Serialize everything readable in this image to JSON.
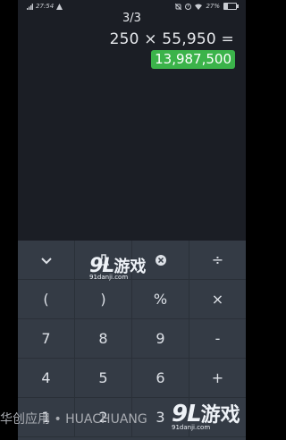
{
  "status_bar": {
    "left_icons": [
      "signal-icon",
      "signal-icon",
      "alert-icon"
    ],
    "time": "27:54",
    "right_icons": [
      "mute-icon",
      "alarm-icon",
      "wifi-icon"
    ],
    "battery_percent": "27%",
    "battery_level": 0.27
  },
  "display": {
    "history_counter": "3/3",
    "expression": "250 × 55,950 =",
    "result": "13,987,500",
    "result_color": "#3bb34a",
    "background": "#1b1e25"
  },
  "keypad": {
    "background": "#343b45",
    "row0": {
      "collapse_icon": "chevron-down-icon",
      "flask_icon": "flask-icon",
      "backspace_icon": "backspace-icon",
      "divide": "÷"
    },
    "row1": {
      "open_paren": "(",
      "close_paren": ")",
      "percent": "%",
      "multiply": "×"
    },
    "row2": {
      "seven": "7",
      "eight": "8",
      "nine": "9",
      "minus": "-"
    },
    "row3": {
      "four": "4",
      "five": "5",
      "six": "6",
      "plus": "+"
    },
    "row4": {
      "one": "1",
      "two": "2",
      "three": "3"
    }
  },
  "watermarks": {
    "center_logo": "9L",
    "center_text": "游戏",
    "center_url": "91danji.com",
    "bottom_logo": "9L",
    "bottom_text": "游戏",
    "bottom_url": "91danji.com",
    "footer": "华创应用 • HUACHUANG"
  }
}
